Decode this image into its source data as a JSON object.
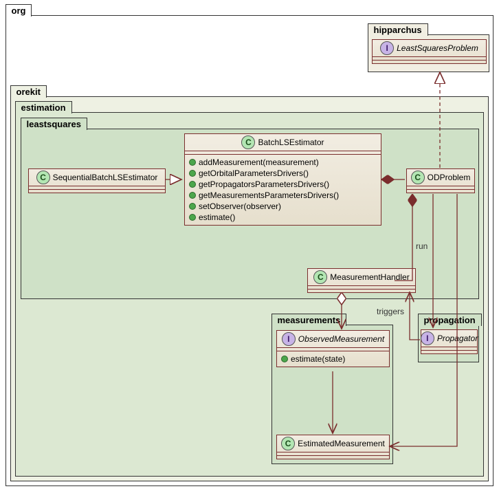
{
  "packages": {
    "org": "org",
    "hipparchus": "hipparchus",
    "orekit": "orekit",
    "estimation": "estimation",
    "leastsquares": "leastsquares",
    "measurements": "measurements",
    "propagation": "propagation"
  },
  "classes": {
    "leastSquaresProblem": {
      "name": "LeastSquaresProblem",
      "type": "I"
    },
    "batchLSEstimator": {
      "name": "BatchLSEstimator",
      "type": "C",
      "methods": [
        "addMeasurement(measurement)",
        "getOrbitalParametersDrivers()",
        "getPropagatorsParametersDrivers()",
        "getMeasurementsParametersDrivers()",
        "setObserver(observer)",
        "estimate()"
      ]
    },
    "sequentialBatchLSEstimator": {
      "name": "SequentialBatchLSEstimator",
      "type": "C"
    },
    "odProblem": {
      "name": "ODProblem",
      "type": "C"
    },
    "measurementHandler": {
      "name": "MeasurementHandler",
      "type": "C"
    },
    "observedMeasurement": {
      "name": "ObservedMeasurement",
      "type": "I",
      "methods": [
        "estimate(state)"
      ]
    },
    "estimatedMeasurement": {
      "name": "EstimatedMeasurement",
      "type": "C"
    },
    "propagator": {
      "name": "Propagator",
      "type": "I"
    }
  },
  "labels": {
    "run": "run",
    "triggers": "triggers"
  }
}
